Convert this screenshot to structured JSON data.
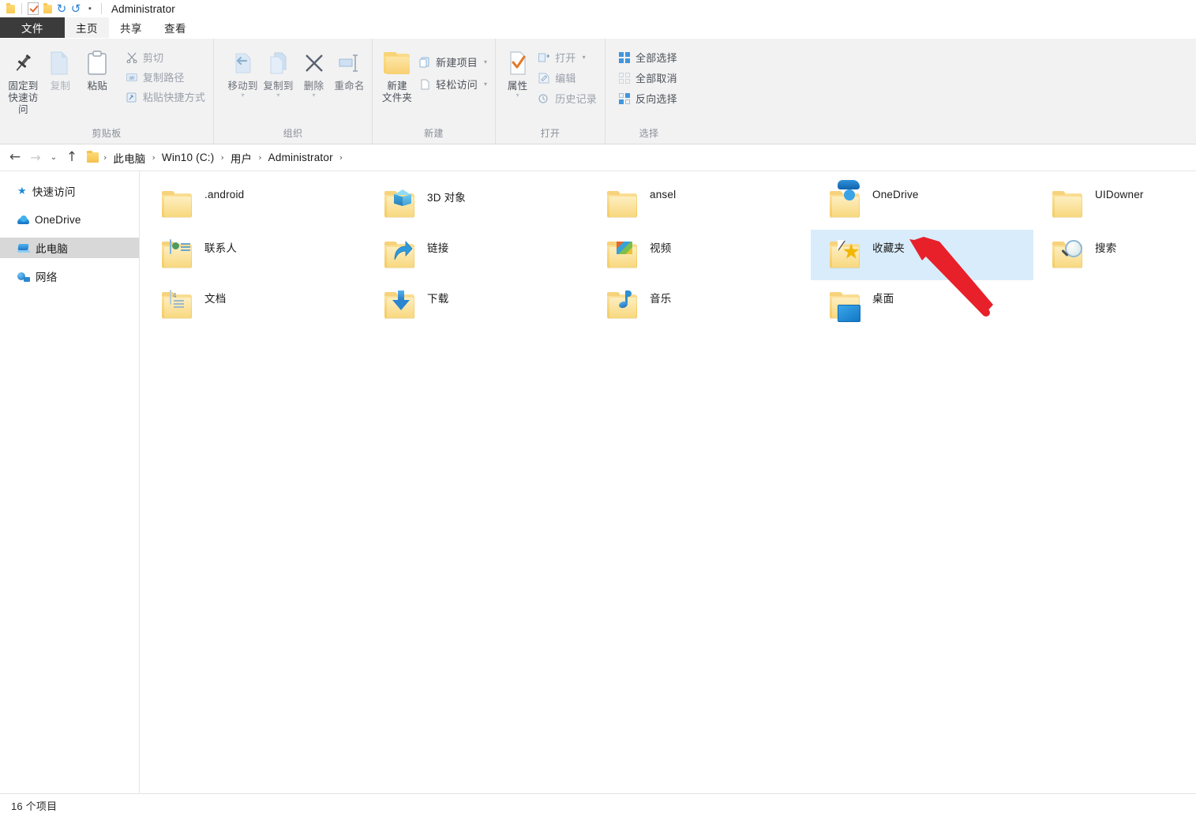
{
  "window": {
    "title": "Administrator",
    "quick_access": [
      {
        "name": "folder-icon",
        "label": "属性"
      },
      {
        "name": "properties-icon",
        "label": "属性"
      },
      {
        "name": "new-folder-icon",
        "label": "新建文件夹"
      },
      {
        "name": "redo-icon",
        "label": "重做"
      },
      {
        "name": "undo-icon",
        "label": "撤消"
      },
      {
        "name": "customize-icon",
        "label": "自定义快速访问工具栏"
      }
    ]
  },
  "tabs": [
    {
      "id": "file",
      "label": "文件"
    },
    {
      "id": "home",
      "label": "主页"
    },
    {
      "id": "share",
      "label": "共享"
    },
    {
      "id": "view",
      "label": "查看"
    }
  ],
  "ribbon": {
    "groups": [
      {
        "id": "clipboard",
        "label": "剪贴板",
        "big": [
          {
            "name": "pin-to-quick-access-button",
            "label": "固定到\n快速访问",
            "line1": "固定到",
            "line2": "快速访问"
          },
          {
            "name": "copy-button",
            "label": "复制",
            "line1": "复制",
            "line2": ""
          },
          {
            "name": "paste-button",
            "label": "粘贴",
            "line1": "粘贴",
            "line2": ""
          }
        ],
        "small": [
          {
            "name": "cut-button",
            "label": "剪切"
          },
          {
            "name": "copy-path-button",
            "label": "复制路径"
          },
          {
            "name": "paste-shortcut-button",
            "label": "粘贴快捷方式"
          }
        ]
      },
      {
        "id": "organize",
        "label": "组织",
        "big": [
          {
            "name": "move-to-button",
            "label": "移动到",
            "line1": "移动到",
            "line2": ""
          },
          {
            "name": "copy-to-button",
            "label": "复制到",
            "line1": "复制到",
            "line2": ""
          },
          {
            "name": "delete-button",
            "label": "删除",
            "line1": "删除",
            "line2": ""
          },
          {
            "name": "rename-button",
            "label": "重命名",
            "line1": "重命名",
            "line2": ""
          }
        ],
        "small": []
      },
      {
        "id": "new",
        "label": "新建",
        "big": [
          {
            "name": "new-folder-button",
            "label": "新建\n文件夹",
            "line1": "新建",
            "line2": "文件夹"
          }
        ],
        "small": [
          {
            "name": "new-item-button",
            "label": "新建项目"
          },
          {
            "name": "easy-access-button",
            "label": "轻松访问"
          }
        ]
      },
      {
        "id": "open",
        "label": "打开",
        "big": [
          {
            "name": "properties-button",
            "label": "属性",
            "line1": "属性",
            "line2": ""
          }
        ],
        "small": [
          {
            "name": "open-button",
            "label": "打开"
          },
          {
            "name": "edit-button",
            "label": "编辑"
          },
          {
            "name": "history-button",
            "label": "历史记录"
          }
        ]
      },
      {
        "id": "select",
        "label": "选择",
        "big": [],
        "small": [
          {
            "name": "select-all-button",
            "label": "全部选择"
          },
          {
            "name": "select-none-button",
            "label": "全部取消"
          },
          {
            "name": "invert-selection-button",
            "label": "反向选择"
          }
        ]
      }
    ]
  },
  "addressbar": {
    "back_label": "←",
    "forward_label": "→",
    "recent_label": "⌄",
    "up_label": "↑",
    "crumbs": [
      "此电脑",
      "Win10 (C:)",
      "用户",
      "Administrator"
    ],
    "separator": "›"
  },
  "sidebar": {
    "items": [
      {
        "label": "快速访问",
        "icon": "star-icon",
        "selected": false
      },
      {
        "label": "OneDrive",
        "icon": "cloud-icon",
        "selected": false
      },
      {
        "label": "此电脑",
        "icon": "this-pc-icon",
        "selected": true
      },
      {
        "label": "网络",
        "icon": "network-icon",
        "selected": false
      }
    ]
  },
  "files": {
    "items": [
      {
        "label": ".android",
        "badge": "none",
        "selected": false
      },
      {
        "label": "3D 对象",
        "badge": "cube-icon",
        "selected": false
      },
      {
        "label": "ansel",
        "badge": "none",
        "selected": false
      },
      {
        "label": "OneDrive",
        "badge": "onedrive-cloud-icon",
        "selected": false
      },
      {
        "label": "UIDowner",
        "badge": "none",
        "selected": false
      },
      {
        "label": "联系人",
        "badge": "contact-card-icon",
        "selected": false
      },
      {
        "label": "链接",
        "badge": "shortcut-arrow-icon",
        "selected": false
      },
      {
        "label": "视频",
        "badge": "film-icon",
        "selected": false
      },
      {
        "label": "收藏夹",
        "badge": "favorites-star-icon",
        "selected": true
      },
      {
        "label": "搜索",
        "badge": "magnifier-icon",
        "selected": false
      },
      {
        "label": "文档",
        "badge": "document-page-icon",
        "selected": false
      },
      {
        "label": "下载",
        "badge": "download-arrow-icon",
        "selected": false
      },
      {
        "label": "音乐",
        "badge": "music-note-icon",
        "selected": false
      },
      {
        "label": "桌面",
        "badge": "monitor-icon",
        "selected": false
      },
      {
        "label": "",
        "badge": "none",
        "selected": false
      }
    ]
  },
  "statusbar": {
    "item_count": "16 个项目"
  },
  "annotation": {
    "arrow_color": "#e8202a",
    "points_to": "收藏夹"
  },
  "colors": {
    "selection_fill": "#d9ecfb",
    "sidebar_selection": "#d8d8d8",
    "ribbon_bg": "#f2f2f2",
    "file_tab_bg": "#3b3b3b",
    "accent_blue": "#1f8bd6",
    "folder_yellow": "#f6d275"
  }
}
